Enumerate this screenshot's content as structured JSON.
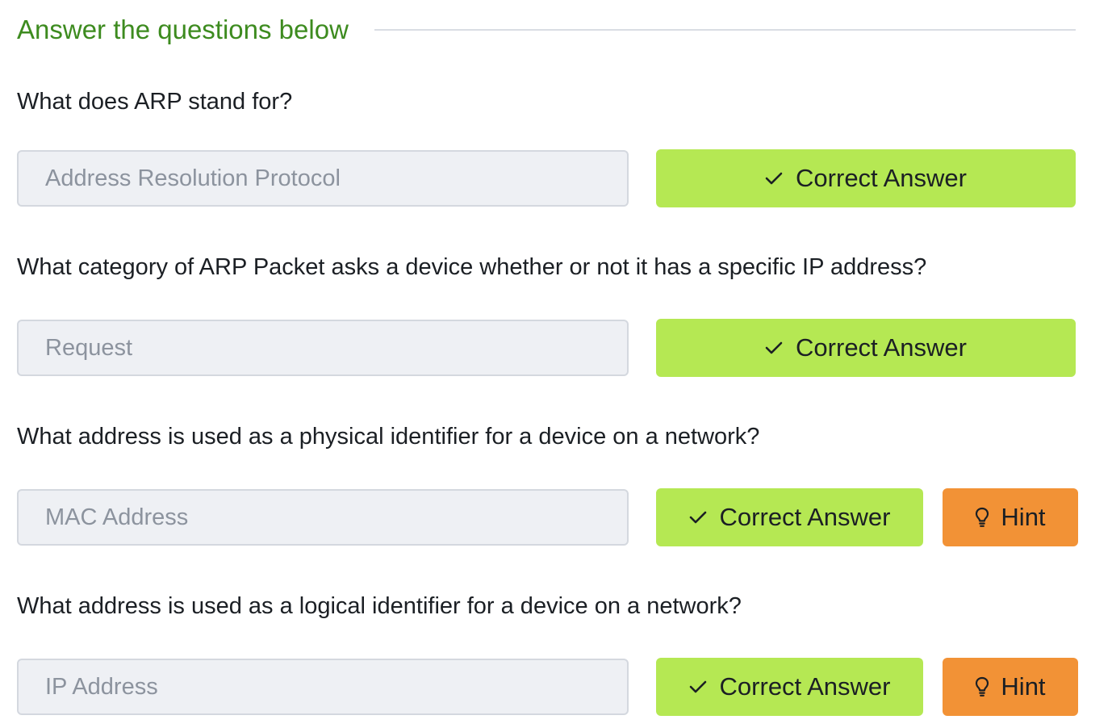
{
  "section": {
    "title": "Answer the questions below"
  },
  "questions": [
    {
      "text": "What does ARP stand for?",
      "answer": "Address Resolution Protocol",
      "status_label": "Correct Answer"
    },
    {
      "text": "What category of ARP Packet asks a device whether or not it has a specific IP address?",
      "answer": "Request",
      "status_label": "Correct Answer"
    },
    {
      "text": "What address is used as a physical identifier for a device on a network?",
      "answer": "MAC Address",
      "status_label": "Correct Answer",
      "hint_label": "Hint"
    },
    {
      "text": "What address is used as a logical identifier for a device on a network?",
      "answer": "IP Address",
      "status_label": "Correct Answer",
      "hint_label": "Hint"
    }
  ],
  "icons": {
    "correct": "check-icon",
    "hint": "lightbulb-icon"
  },
  "colors": {
    "title": "#3d8b1f",
    "correct_button": "#b5e853",
    "hint_button": "#f29236",
    "field_background": "#eef0f4",
    "field_text": "#8c939e"
  }
}
